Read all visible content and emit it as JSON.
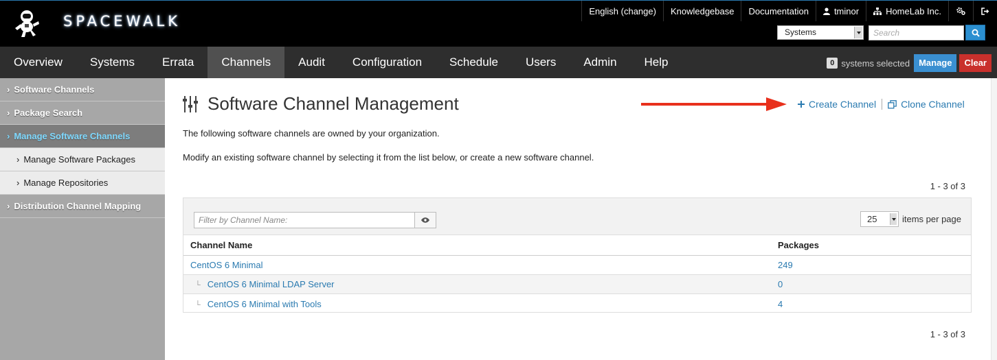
{
  "app": {
    "brand": "SPACEWALK"
  },
  "utility": {
    "language": "English (change)",
    "knowledgebase": "Knowledgebase",
    "documentation": "Documentation",
    "user": "tminor",
    "organization": "HomeLab Inc."
  },
  "search": {
    "type_selected": "Systems",
    "placeholder": "Search"
  },
  "nav": {
    "tabs": [
      "Overview",
      "Systems",
      "Errata",
      "Channels",
      "Audit",
      "Configuration",
      "Schedule",
      "Users",
      "Admin",
      "Help"
    ],
    "active": "Channels"
  },
  "ssm": {
    "count": "0",
    "label": "systems selected",
    "manage_label": "Manage",
    "clear_label": "Clear"
  },
  "sidebar": {
    "items": [
      {
        "label": "Software Channels"
      },
      {
        "label": "Package Search"
      },
      {
        "label": "Manage Software Channels"
      },
      {
        "label": "Manage Software Packages"
      },
      {
        "label": "Manage Repositories"
      },
      {
        "label": "Distribution Channel Mapping"
      }
    ]
  },
  "page": {
    "title": "Software Channel Management",
    "create_label": "Create Channel",
    "clone_label": "Clone Channel",
    "intro1": "The following software channels are owned by your organization.",
    "intro2": "Modify an existing software channel by selecting it from the list below, or create a new software channel.",
    "pager": "1 - 3 of 3"
  },
  "list": {
    "filter_placeholder": "Filter by Channel Name:",
    "per_page": "25",
    "per_page_label": "items per page",
    "headers": {
      "name": "Channel Name",
      "packages": "Packages"
    },
    "rows": [
      {
        "name": "CentOS 6 Minimal",
        "packages": "249"
      },
      {
        "name": "CentOS 6 Minimal LDAP Server",
        "packages": "0"
      },
      {
        "name": "CentOS 6 Minimal with Tools",
        "packages": "4"
      }
    ]
  },
  "colors": {
    "accent": "#2a7ab0",
    "arrow": "#e8301c",
    "manage": "#3a8fd1",
    "clear": "#c9302c",
    "sidebar_active_text": "#7fd9ff"
  }
}
